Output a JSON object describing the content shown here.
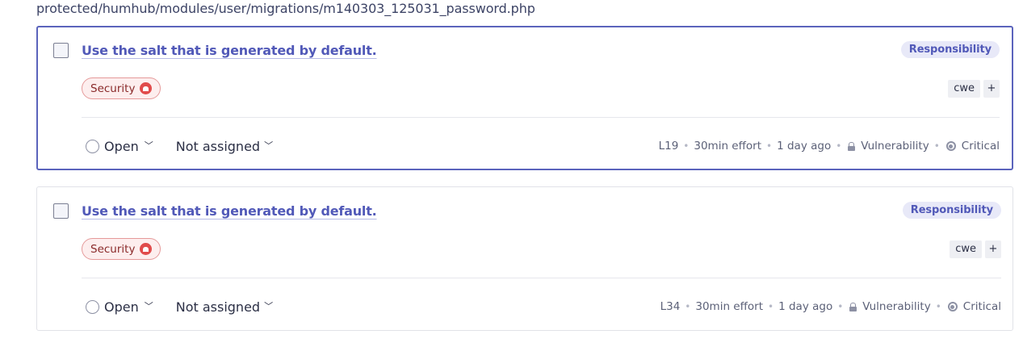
{
  "file_path": "protected/humhub/modules/user/migrations/m140303_125031_password.php",
  "issues": [
    {
      "title": "Use the salt that is generated by default.",
      "attribute": "Responsibility",
      "quality": "Security",
      "tags": [
        "cwe"
      ],
      "add_tag": "+",
      "status": "Open",
      "assignee": "Not assigned",
      "line": "L19",
      "effort": "30min effort",
      "age": "1 day ago",
      "type": "Vulnerability",
      "severity": "Critical",
      "selected": true
    },
    {
      "title": "Use the salt that is generated by default.",
      "attribute": "Responsibility",
      "quality": "Security",
      "tags": [
        "cwe"
      ],
      "add_tag": "+",
      "status": "Open",
      "assignee": "Not assigned",
      "line": "L34",
      "effort": "30min effort",
      "age": "1 day ago",
      "type": "Vulnerability",
      "severity": "Critical",
      "selected": false
    }
  ],
  "separator": "•",
  "chevron": "﹀"
}
